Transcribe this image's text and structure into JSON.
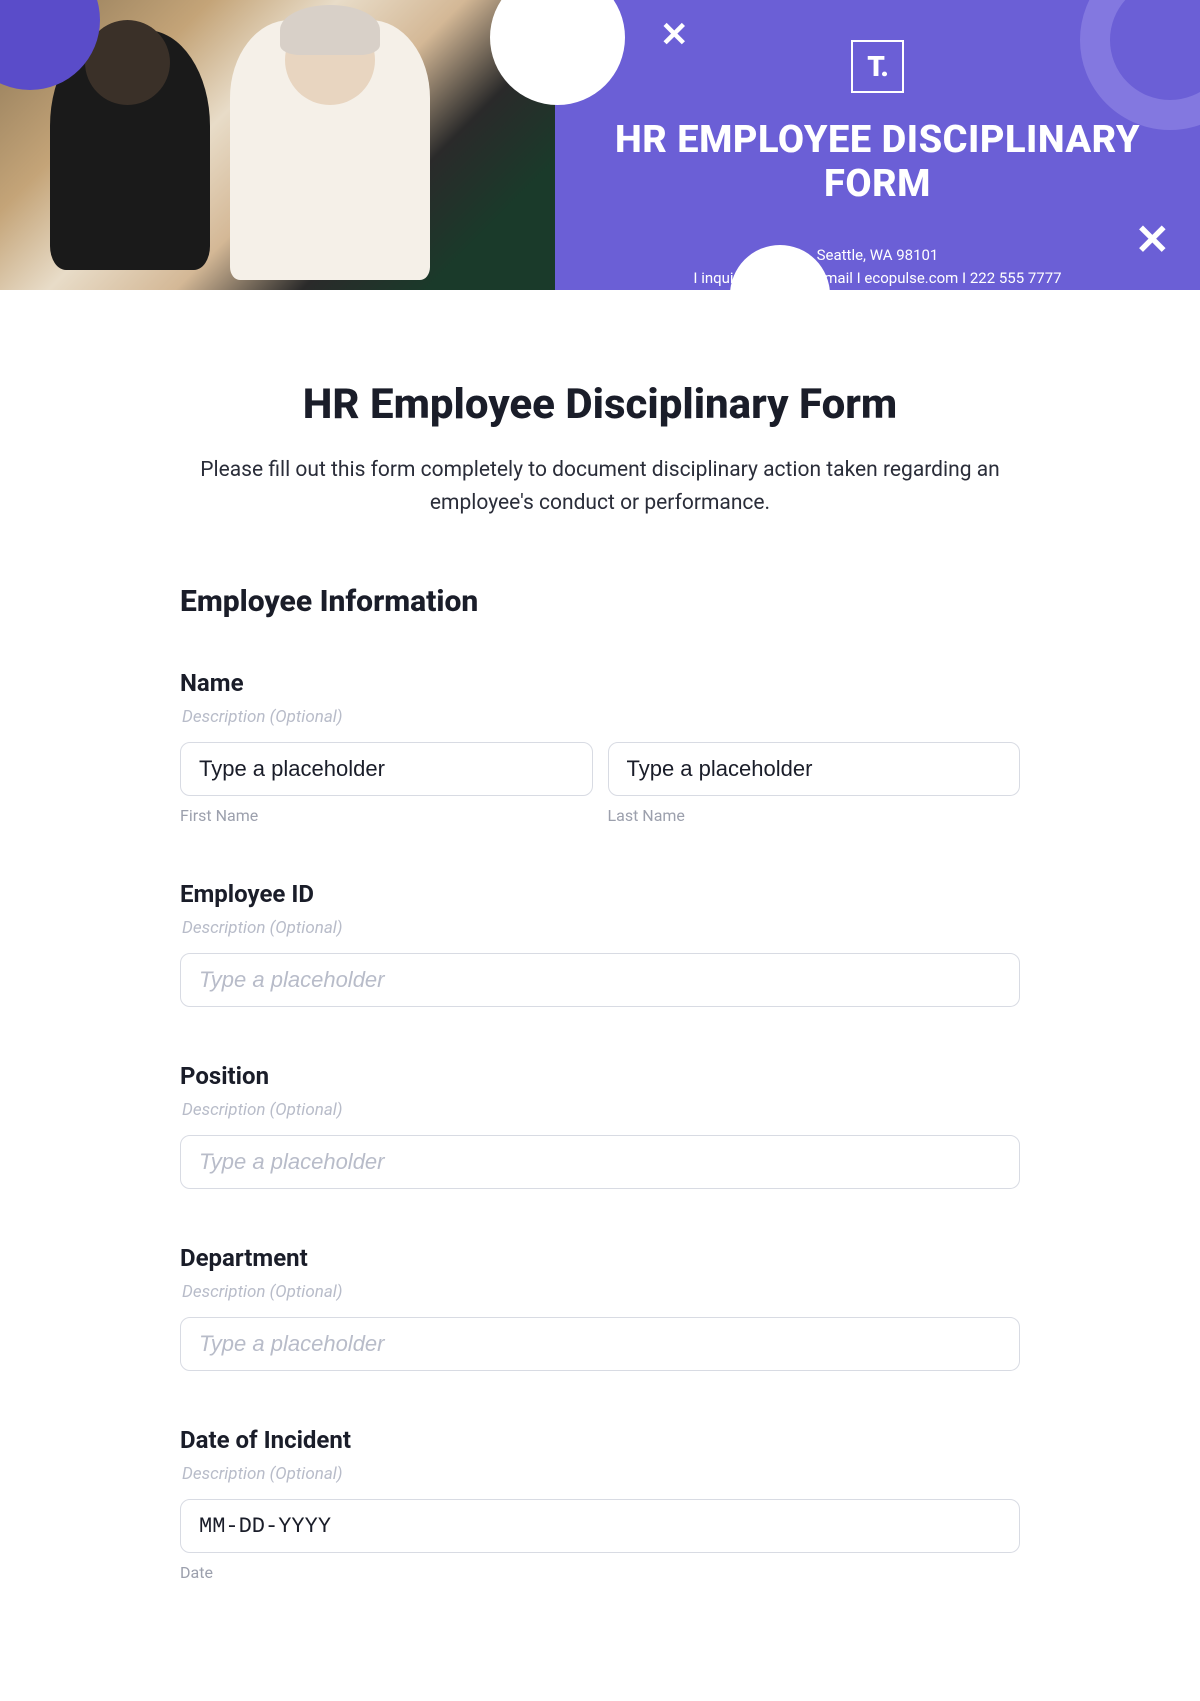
{
  "banner": {
    "logo": "T.",
    "title": "HR EMPLOYEE DISCIPLINARY FORM",
    "address": "Seattle, WA 98101",
    "contact": "I  inquire@ecopulse.mail I   ecopulse.com I   222 555 7777"
  },
  "form": {
    "title": "HR Employee Disciplinary Form",
    "subtitle": "Please fill out this form completely to document disciplinary action taken regarding an employee's conduct or performance.",
    "section_title": "Employee Information",
    "description_optional": "Description (Optional)",
    "placeholder_text": "Type a placeholder",
    "fields": {
      "name": {
        "label": "Name",
        "first_name_sublabel": "First Name",
        "last_name_sublabel": "Last Name"
      },
      "employee_id": {
        "label": "Employee ID"
      },
      "position": {
        "label": "Position"
      },
      "department": {
        "label": "Department"
      },
      "date_of_incident": {
        "label": "Date of Incident",
        "placeholder": "MM-DD-YYYY",
        "sublabel": "Date"
      }
    }
  }
}
